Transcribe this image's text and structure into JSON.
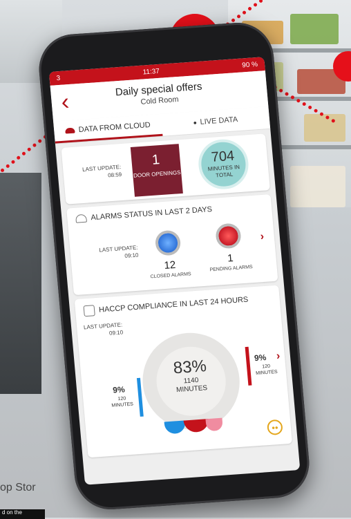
{
  "status": {
    "carrier": "3",
    "time": "11:37",
    "battery": "90 %"
  },
  "header": {
    "title": "Daily special offers",
    "subtitle": "Cold Room"
  },
  "tabs": [
    {
      "label": "DATA FROM CLOUD"
    },
    {
      "label": "LIVE DATA"
    }
  ],
  "doors": {
    "last_update_label": "LAST UPDATE:",
    "last_update_time": "08:59",
    "door_count": "1",
    "door_label": "DOOR OPENINGS",
    "minutes": "704",
    "minutes_label": "MINUTES IN TOTAL"
  },
  "alarms": {
    "title": "ALARMS STATUS IN LAST 2 DAYS",
    "last_update_label": "LAST UPDATE:",
    "last_update_time": "09:10",
    "closed_count": "12",
    "closed_label": "CLOSED ALARMS",
    "pending_count": "1",
    "pending_label": "PENDING ALARMS"
  },
  "haccp": {
    "title": "HACCP COMPLIANCE IN LAST 24 HOURS",
    "last_update_label": "LAST UPDATE:",
    "last_update_time": "09:10",
    "center_pct": "83%",
    "center_minutes": "1140",
    "center_minutes_label": "MINUTES",
    "left_pct": "9%",
    "left_minutes": "120",
    "left_minutes_label": "MINUTES",
    "right_pct": "9%",
    "right_minutes": "120",
    "right_minutes_label": "MINUTES",
    "colors": {
      "low": "#1f8fe0",
      "high": "#c4121b",
      "ok": "#e6e5e3"
    }
  },
  "background": {
    "bottom_text": "op Stor",
    "badge_text": "d on the"
  }
}
